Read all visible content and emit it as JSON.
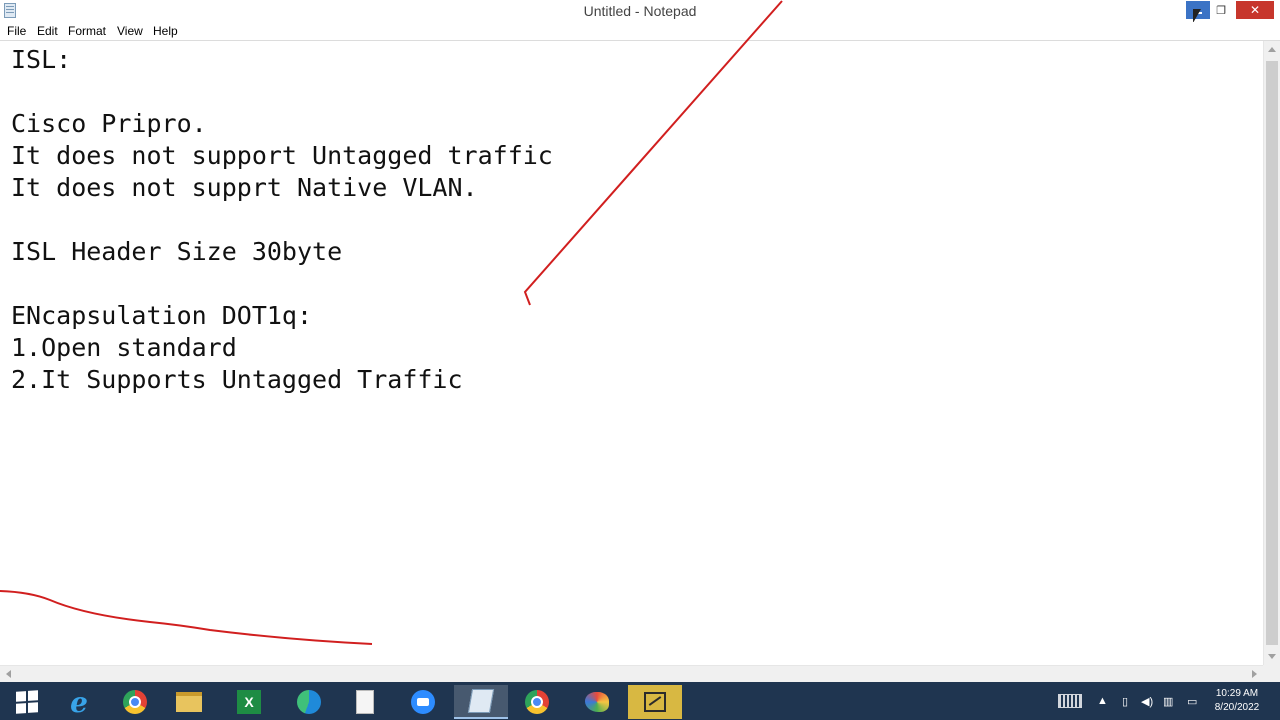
{
  "window": {
    "title": "Untitled - Notepad",
    "close_glyph": "✕",
    "maximize_glyph": "❐"
  },
  "menu": [
    "File",
    "Edit",
    "Format",
    "View",
    "Help"
  ],
  "editor": {
    "lines": [
      "ISL:",
      "",
      "Cisco Pripro.",
      "It does not support Untagged traffic",
      "It does not supprt Native VLAN.",
      "",
      "ISL Header Size 30byte",
      "",
      "ENcapsulation DOT1q:",
      "1.Open standard",
      "2.It Supports Untagged Traffic"
    ]
  },
  "annotation_color": "#d11f1f",
  "taskbar": {
    "icons": [
      "windows-start-icon",
      "internet-explorer-icon",
      "chrome-icon",
      "file-explorer-icon",
      "excel-icon",
      "edge-icon",
      "notepad-file-icon",
      "zoom-icon",
      "notepad-app-icon",
      "chrome-profile-icon",
      "paint-icon",
      "annotation-tool-icon"
    ],
    "clock": {
      "time": "10:29 AM",
      "date": "8/20/2022"
    }
  }
}
